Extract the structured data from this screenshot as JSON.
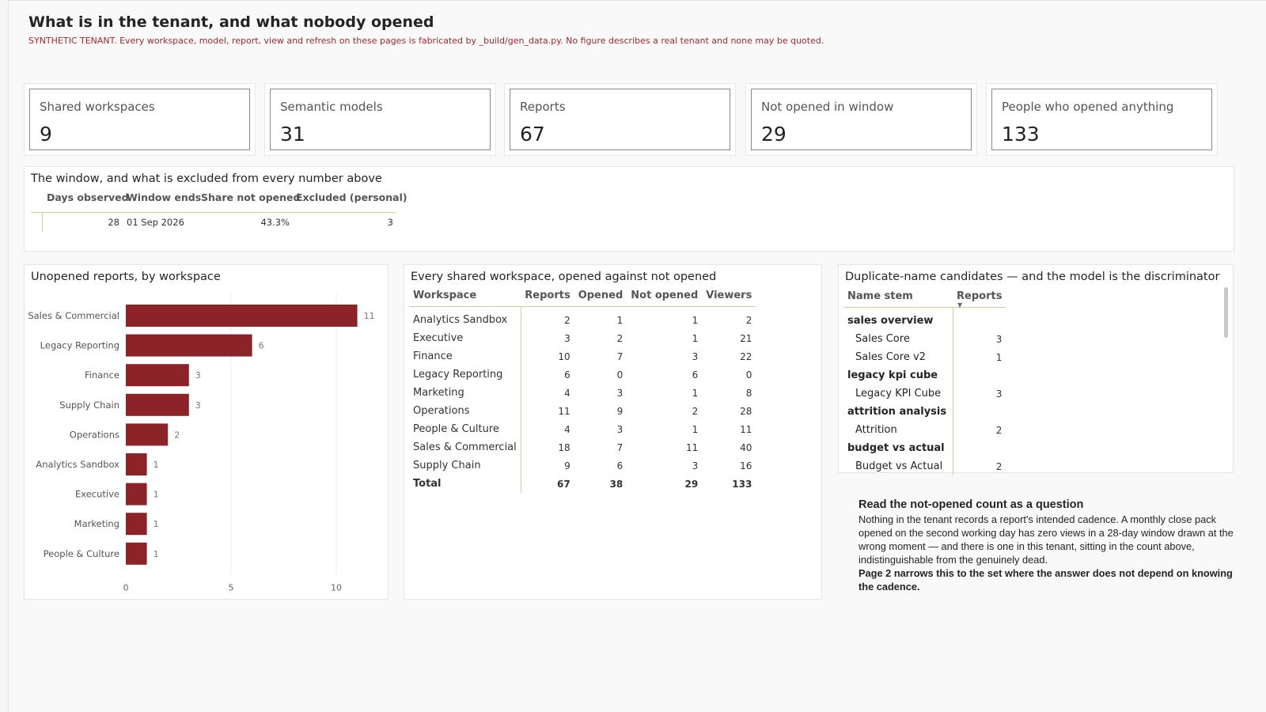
{
  "page": {
    "title": "What is in the tenant, and what nobody opened",
    "subtitle": "SYNTHETIC TENANT. Every workspace, model, report, view and refresh on these pages is fabricated by _build/gen_data.py. No figure describes a real tenant and none may be quoted."
  },
  "cards": [
    {
      "label": "Shared workspaces",
      "value": "9"
    },
    {
      "label": "Semantic models",
      "value": "31"
    },
    {
      "label": "Reports",
      "value": "67"
    },
    {
      "label": "Not opened in window",
      "value": "29"
    },
    {
      "label": "People who opened anything",
      "value": "133"
    }
  ],
  "window": {
    "title": "The window, and what is excluded from every number above",
    "headers": [
      "Days observed",
      "Window ends",
      "Share not opened",
      "Excluded (personal)"
    ],
    "row": [
      "28",
      "01 Sep 2026",
      "43.3%",
      "3"
    ]
  },
  "colors": {
    "bar": "#8b2328",
    "accent_line": "#d9c9a0",
    "subtitle": "#a4262c"
  },
  "chart_data": {
    "type": "bar",
    "orientation": "horizontal",
    "title": "Unopened reports, by workspace",
    "categories": [
      "Sales & Commercial",
      "Legacy Reporting",
      "Finance",
      "Supply Chain",
      "Operations",
      "Analytics Sandbox",
      "Executive",
      "Marketing",
      "People & Culture"
    ],
    "values": [
      11,
      6,
      3,
      3,
      2,
      1,
      1,
      1,
      1
    ],
    "xlim": [
      0,
      11
    ],
    "xticks": [
      0,
      5,
      10
    ],
    "grid": true
  },
  "workspaces": {
    "title": "Every shared workspace, opened against not opened",
    "headers": [
      "Workspace",
      "Reports",
      "Opened",
      "Not opened",
      "Viewers"
    ],
    "rows": [
      [
        "Analytics Sandbox",
        "2",
        "1",
        "1",
        "2"
      ],
      [
        "Executive",
        "3",
        "2",
        "1",
        "21"
      ],
      [
        "Finance",
        "10",
        "7",
        "3",
        "22"
      ],
      [
        "Legacy Reporting",
        "6",
        "0",
        "6",
        "0"
      ],
      [
        "Marketing",
        "4",
        "3",
        "1",
        "8"
      ],
      [
        "Operations",
        "11",
        "9",
        "2",
        "28"
      ],
      [
        "People & Culture",
        "4",
        "3",
        "1",
        "11"
      ],
      [
        "Sales & Commercial",
        "18",
        "7",
        "11",
        "40"
      ],
      [
        "Supply Chain",
        "9",
        "6",
        "3",
        "16"
      ]
    ],
    "total": [
      "Total",
      "67",
      "38",
      "29",
      "133"
    ]
  },
  "duplicates": {
    "title": "Duplicate-name candidates — and the model is the discriminator",
    "headers": [
      "Name stem",
      "Reports"
    ],
    "groups": [
      {
        "stem": "sales overview",
        "children": [
          [
            "Sales Core",
            "3"
          ],
          [
            "Sales Core v2",
            "1"
          ]
        ]
      },
      {
        "stem": "legacy kpi cube",
        "children": [
          [
            "Legacy KPI Cube",
            "3"
          ]
        ]
      },
      {
        "stem": "attrition analysis",
        "children": [
          [
            "Attrition",
            "2"
          ]
        ]
      },
      {
        "stem": "budget vs actual",
        "children": [
          [
            "Budget vs Actual",
            "2"
          ]
        ]
      }
    ]
  },
  "note": {
    "heading": "Read the not-opened count as a question",
    "body": "Nothing in the tenant records a report's intended cadence. A monthly close pack opened on the second working day has zero views in a 28-day window drawn at the wrong moment — and there is one in this tenant, sitting in the count above, indistinguishable from the genuinely dead.",
    "bold": "Page 2 narrows this to the set where the answer does not depend on knowing the cadence."
  }
}
